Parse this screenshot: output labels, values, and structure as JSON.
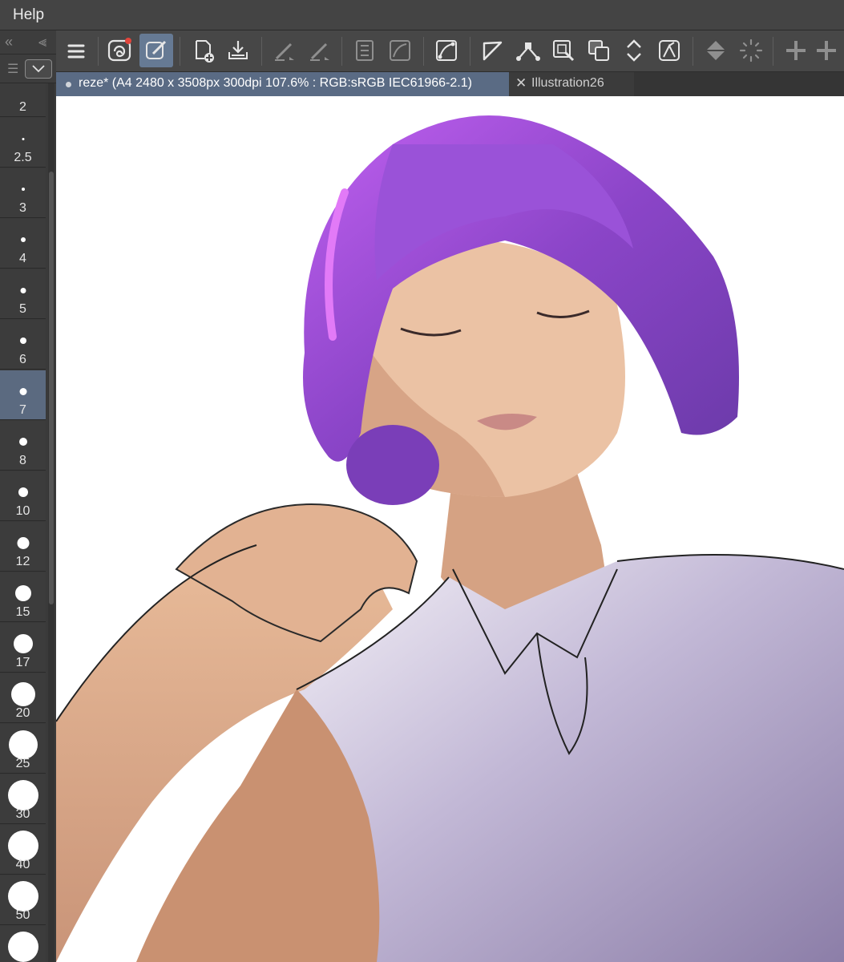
{
  "menubar": {
    "help": "Help"
  },
  "brush_sizes": {
    "items": [
      {
        "label": "2",
        "dot": 0
      },
      {
        "label": "2.5",
        "dot": 3
      },
      {
        "label": "3",
        "dot": 4
      },
      {
        "label": "4",
        "dot": 6
      },
      {
        "label": "5",
        "dot": 7
      },
      {
        "label": "6",
        "dot": 8
      },
      {
        "label": "7",
        "dot": 9
      },
      {
        "label": "8",
        "dot": 10
      },
      {
        "label": "10",
        "dot": 12
      },
      {
        "label": "12",
        "dot": 15
      },
      {
        "label": "15",
        "dot": 20
      },
      {
        "label": "17",
        "dot": 24
      },
      {
        "label": "20",
        "dot": 30
      },
      {
        "label": "25",
        "dot": 36
      },
      {
        "label": "30",
        "dot": 38
      },
      {
        "label": "40",
        "dot": 38
      },
      {
        "label": "50",
        "dot": 38
      },
      {
        "label": "",
        "dot": 38
      }
    ],
    "selected": "7"
  },
  "toolbar": {
    "items": [
      "menu-icon",
      "clip-studio-icon",
      "edit-pen-icon",
      "new-canvas-icon",
      "import-icon",
      "pen-pressure-icon",
      "pen-stabilizer-icon",
      "layer-property-icon",
      "reference-icon",
      "transform-icon",
      "fill-corner-icon",
      "vector-line-icon",
      "select-layer-icon",
      "copy-layer-icon",
      "flip-icon",
      "rotate-canvas-icon",
      "fill-icon",
      "loading-icon",
      "zoom-in-icon",
      "zoom-out-icon"
    ],
    "badge_color": "#e2453c"
  },
  "tabs": [
    {
      "label": "reze* (A4 2480 x 3508px 300dpi 107.6% : RGB:sRGB IEC61966-2.1)",
      "active": true
    },
    {
      "label": "Illustration26",
      "active": false
    }
  ],
  "colors": {
    "menubar": "#444444",
    "panel": "#3a3a3a",
    "selected": "#5b6a80",
    "tab_active": "#5a6b84",
    "hair": "#8e44d6",
    "skin": "#e5b493",
    "shirt": "#b9aecd"
  }
}
